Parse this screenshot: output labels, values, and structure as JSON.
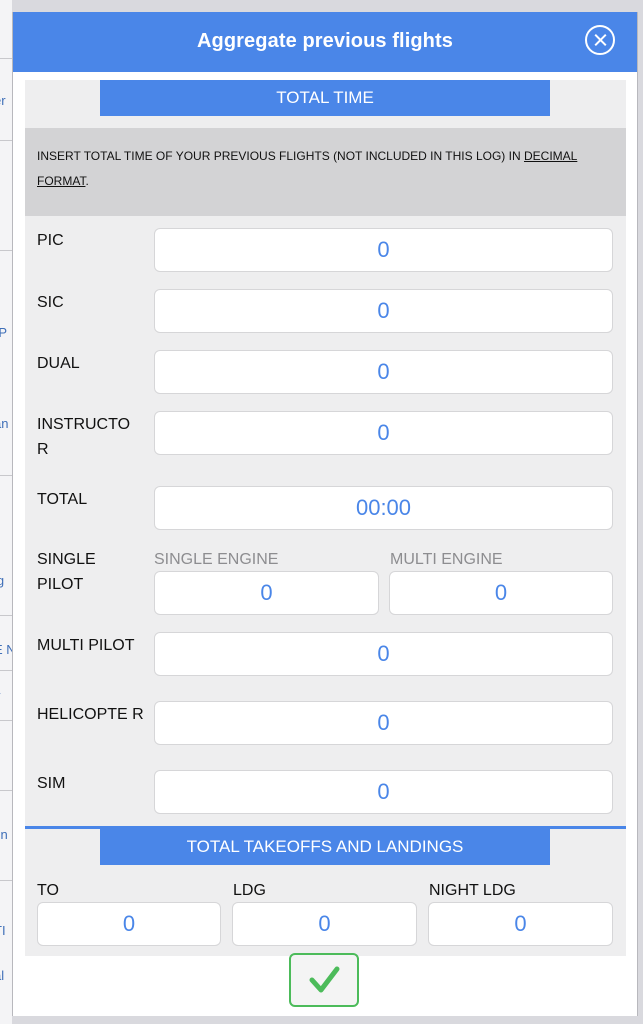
{
  "background_page": {
    "row_fragments": [
      "er",
      "(P",
      "an",
      "ig",
      "E N",
      "y",
      "tin",
      "TI",
      "al"
    ]
  },
  "modal": {
    "title": "Aggregate previous flights",
    "close_icon": "close-circle-icon",
    "confirm_icon": "checkmark-icon",
    "accent_color": "#4a86e8",
    "confirm_color": "#4cbb5a"
  },
  "total_time": {
    "header": "TOTAL TIME",
    "instructions_prefix": "INSERT TOTAL TIME OF YOUR PREVIOUS FLIGHTS (NOT INCLUDED IN THIS LOG) IN ",
    "instructions_link": "DECIMAL FORMAT",
    "instructions_suffix": ".",
    "rows": {
      "pic": {
        "label": "PIC",
        "value": "0"
      },
      "sic": {
        "label": "SIC",
        "value": "0"
      },
      "dual": {
        "label": "DUAL",
        "value": "0"
      },
      "instructor": {
        "label": "INSTRUCTO R",
        "value": "0"
      },
      "total": {
        "label": "TOTAL",
        "value": "00:00"
      },
      "single_pilot": {
        "label": "SINGLE PILOT",
        "single_engine_label": "SINGLE ENGINE",
        "single_engine_value": "0",
        "multi_engine_label": "MULTI ENGINE",
        "multi_engine_value": "0"
      },
      "multi_pilot": {
        "label": "MULTI PILOT",
        "value": "0"
      },
      "helicopter": {
        "label": "HELICOPTE R",
        "value": "0"
      },
      "sim": {
        "label": "SIM",
        "value": "0"
      }
    }
  },
  "takeoffs_landings": {
    "header": "TOTAL TAKEOFFS AND LANDINGS",
    "to": {
      "label": "TO",
      "value": "0"
    },
    "ldg": {
      "label": "LDG",
      "value": "0"
    },
    "night_ldg": {
      "label": "NIGHT LDG",
      "value": "0"
    }
  }
}
